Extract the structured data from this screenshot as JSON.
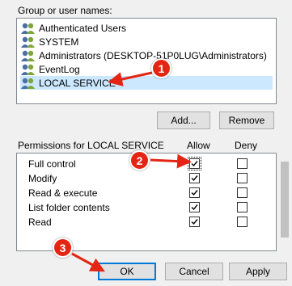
{
  "group_label": "Group or user names:",
  "users": [
    {
      "name": "Authenticated Users",
      "selected": false
    },
    {
      "name": "SYSTEM",
      "selected": false
    },
    {
      "name": "Administrators (DESKTOP-51P0LUG\\Administrators)",
      "selected": false
    },
    {
      "name": "EventLog",
      "selected": false
    },
    {
      "name": "LOCAL SERVICE",
      "selected": true
    }
  ],
  "buttons": {
    "add": "Add...",
    "remove": "Remove",
    "ok": "OK",
    "cancel": "Cancel",
    "apply": "Apply"
  },
  "permissions": {
    "header": "Permissions for LOCAL SERVICE",
    "allow_header": "Allow",
    "deny_header": "Deny",
    "rows": [
      {
        "label": "Full control",
        "allow": true,
        "deny": false
      },
      {
        "label": "Modify",
        "allow": true,
        "deny": false
      },
      {
        "label": "Read & execute",
        "allow": true,
        "deny": false
      },
      {
        "label": "List folder contents",
        "allow": true,
        "deny": false
      },
      {
        "label": "Read",
        "allow": true,
        "deny": false
      }
    ]
  },
  "annotations": {
    "step1": "1",
    "step2": "2",
    "step3": "3",
    "color": "#e42513"
  }
}
